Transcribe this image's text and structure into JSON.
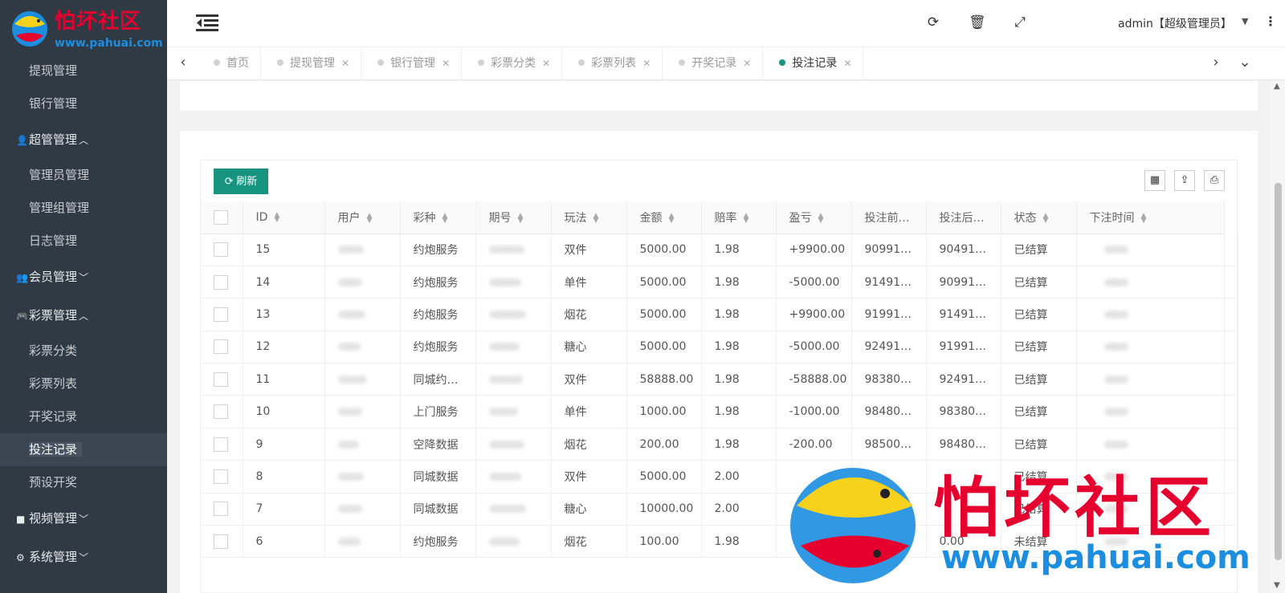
{
  "logo": {
    "title": "怕坏社区",
    "url": "www.pahuai.com"
  },
  "sidebar": {
    "items": [
      {
        "kind": "item",
        "label": "提现管理",
        "icon": ""
      },
      {
        "kind": "item",
        "label": "银行管理",
        "icon": ""
      },
      {
        "kind": "group",
        "label": "超管管理",
        "icon": "user-icon",
        "expanded": true
      },
      {
        "kind": "item",
        "label": "管理员管理",
        "icon": ""
      },
      {
        "kind": "item",
        "label": "管理组管理",
        "icon": ""
      },
      {
        "kind": "item",
        "label": "日志管理",
        "icon": ""
      },
      {
        "kind": "group",
        "label": "会员管理",
        "icon": "users-icon",
        "expanded": false
      },
      {
        "kind": "group",
        "label": "彩票管理",
        "icon": "gamepad-icon",
        "expanded": true
      },
      {
        "kind": "item",
        "label": "彩票分类",
        "icon": ""
      },
      {
        "kind": "item",
        "label": "彩票列表",
        "icon": ""
      },
      {
        "kind": "item",
        "label": "开奖记录",
        "icon": ""
      },
      {
        "kind": "item",
        "label": "投注记录",
        "icon": "",
        "active": true
      },
      {
        "kind": "item",
        "label": "预设开奖",
        "icon": ""
      },
      {
        "kind": "group",
        "label": "视频管理",
        "icon": "video-icon",
        "expanded": false
      },
      {
        "kind": "group",
        "label": "系统管理",
        "icon": "gear-icon",
        "expanded": false
      }
    ]
  },
  "header": {
    "admin_label": "admin【超级管理员】",
    "icons": [
      "refresh-icon",
      "trash-icon",
      "fullscreen-icon"
    ]
  },
  "tabs": [
    {
      "label": "首页",
      "closable": false,
      "active": false
    },
    {
      "label": "提现管理",
      "closable": true,
      "active": false
    },
    {
      "label": "银行管理",
      "closable": true,
      "active": false
    },
    {
      "label": "彩票分类",
      "closable": true,
      "active": false
    },
    {
      "label": "彩票列表",
      "closable": true,
      "active": false
    },
    {
      "label": "开奖记录",
      "closable": true,
      "active": false
    },
    {
      "label": "投注记录",
      "closable": true,
      "active": true
    }
  ],
  "toolbar": {
    "refresh_label": "刷新",
    "tools": [
      "columns-icon",
      "export-icon",
      "print-icon"
    ]
  },
  "table": {
    "columns": [
      "ID",
      "用户",
      "彩种",
      "期号",
      "玩法",
      "金额",
      "赔率",
      "盈亏",
      "投注前…",
      "投注后…",
      "状态",
      "下注时间"
    ],
    "rows": [
      {
        "id": "15",
        "lottery": "约炮服务",
        "play": "双件",
        "amount": "5000.00",
        "odds": "1.98",
        "profit": "+9900.00",
        "before": "90991…",
        "after": "90491…",
        "status": "已结算"
      },
      {
        "id": "14",
        "lottery": "约炮服务",
        "play": "单件",
        "amount": "5000.00",
        "odds": "1.98",
        "profit": "-5000.00",
        "before": "91491…",
        "after": "90991…",
        "status": "已结算"
      },
      {
        "id": "13",
        "lottery": "约炮服务",
        "play": "烟花",
        "amount": "5000.00",
        "odds": "1.98",
        "profit": "+9900.00",
        "before": "91991…",
        "after": "91491…",
        "status": "已结算"
      },
      {
        "id": "12",
        "lottery": "约炮服务",
        "play": "糖心",
        "amount": "5000.00",
        "odds": "1.98",
        "profit": "-5000.00",
        "before": "92491…",
        "after": "91991…",
        "status": "已结算"
      },
      {
        "id": "11",
        "lottery": "同城约…",
        "play": "双件",
        "amount": "58888.00",
        "odds": "1.98",
        "profit": "-58888.00",
        "before": "98380…",
        "after": "92491…",
        "status": "已结算"
      },
      {
        "id": "10",
        "lottery": "上门服务",
        "play": "单件",
        "amount": "1000.00",
        "odds": "1.98",
        "profit": "-1000.00",
        "before": "98480…",
        "after": "98380…",
        "status": "已结算"
      },
      {
        "id": "9",
        "lottery": "空降数据",
        "play": "烟花",
        "amount": "200.00",
        "odds": "1.98",
        "profit": "-200.00",
        "before": "98500…",
        "after": "98480…",
        "status": "已结算"
      },
      {
        "id": "8",
        "lottery": "同城数据",
        "play": "双件",
        "amount": "5000.00",
        "odds": "2.00",
        "profit": "",
        "before": "",
        "after": "",
        "status": "已结算"
      },
      {
        "id": "7",
        "lottery": "同城数据",
        "play": "糖心",
        "amount": "10000.00",
        "odds": "2.00",
        "profit": "",
        "before": "",
        "after": "",
        "status": "已结算"
      },
      {
        "id": "6",
        "lottery": "约炮服务",
        "play": "烟花",
        "amount": "100.00",
        "odds": "1.98",
        "profit": "",
        "before": "",
        "after": "0.00",
        "status": "未结算"
      }
    ]
  },
  "watermark": {
    "title": "怕坏社区",
    "url": "www.pahuai.com"
  },
  "colors": {
    "accent": "#16947f",
    "sidebar_bg": "#2f3a45",
    "profit_positive": "#2e8b2e",
    "profit_negative": "#d23030",
    "brand_red": "#e6002d",
    "brand_blue": "#1b8ee0"
  }
}
